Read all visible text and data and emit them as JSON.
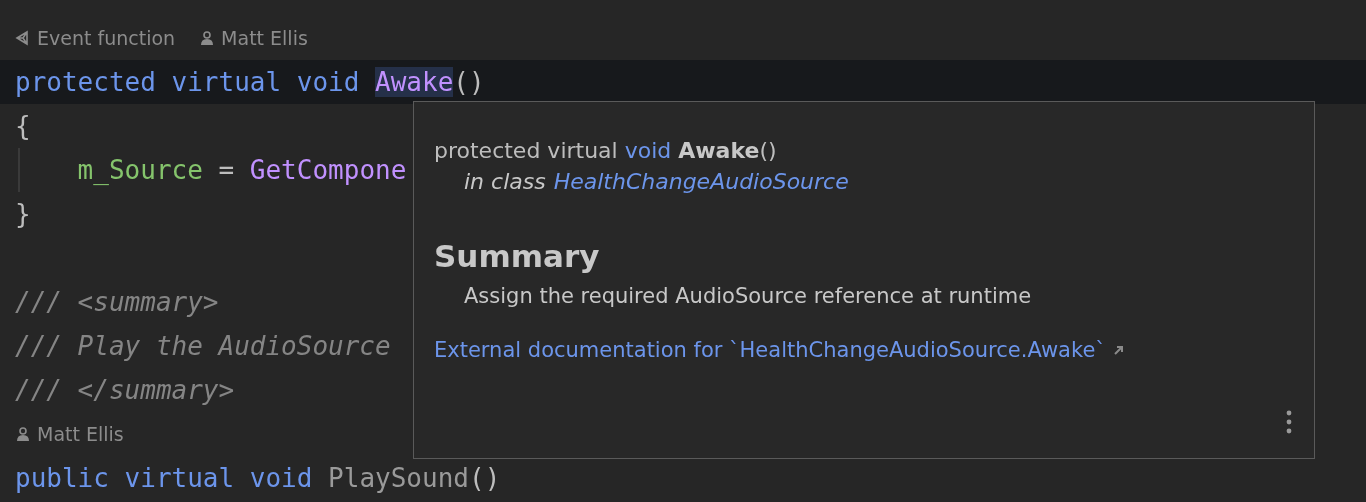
{
  "editor": {
    "lines": [
      {
        "kind": "codevision",
        "items": [
          {
            "kind": "event",
            "text": "Event function"
          },
          {
            "kind": "author",
            "text": "Matt Ellis"
          }
        ]
      },
      {
        "kind": "code",
        "current": true,
        "segments": [
          {
            "text": "protected ",
            "kind": "keyword"
          },
          {
            "text": "virtual ",
            "kind": "keyword"
          },
          {
            "text": "void ",
            "kind": "keyword"
          },
          {
            "text": "Awake",
            "kind": "method",
            "highlighted": true
          },
          {
            "text": "()",
            "kind": "plain"
          }
        ]
      },
      {
        "kind": "code",
        "current": false,
        "segments": [
          {
            "text": "{",
            "kind": "plain"
          }
        ]
      },
      {
        "kind": "code",
        "current": false,
        "segments": [
          {
            "text": "    m_Source",
            "kind": "field"
          },
          {
            "text": " = ",
            "kind": "plain"
          },
          {
            "text": "GetCompone",
            "kind": "method"
          }
        ]
      },
      {
        "kind": "code",
        "current": false,
        "segments": [
          {
            "text": "}",
            "kind": "plain"
          }
        ]
      },
      {
        "kind": "blank"
      },
      {
        "kind": "code",
        "current": false,
        "segments": [
          {
            "text": "/// <summary>",
            "kind": "comment"
          }
        ]
      },
      {
        "kind": "code",
        "current": false,
        "segments": [
          {
            "text": "/// Play the AudioSource",
            "kind": "comment"
          }
        ]
      },
      {
        "kind": "code",
        "current": false,
        "segments": [
          {
            "text": "/// </summary>",
            "kind": "comment"
          }
        ]
      },
      {
        "kind": "codevision",
        "items": [
          {
            "kind": "author",
            "text": "Matt Ellis"
          }
        ]
      },
      {
        "kind": "code",
        "current": false,
        "segments": [
          {
            "text": "public ",
            "kind": "keyword"
          },
          {
            "text": "virtual ",
            "kind": "keyword"
          },
          {
            "text": "void ",
            "kind": "keyword"
          },
          {
            "text": "PlaySound",
            "kind": "unused"
          },
          {
            "text": "()",
            "kind": "plain"
          }
        ]
      }
    ]
  },
  "popup": {
    "signature": [
      {
        "text": "protected virtual ",
        "kind": "plain"
      },
      {
        "text": "void ",
        "kind": "keyword"
      },
      {
        "text": "Awake",
        "kind": "name"
      },
      {
        "text": "()",
        "kind": "plain"
      }
    ],
    "context_label": "in class",
    "context_link": "HealthChangeAudioSource",
    "heading": "Summary",
    "description": "Assign the required AudioSource reference at runtime",
    "external_link": "External documentation for `HealthChangeAudioSource.Awake`"
  }
}
